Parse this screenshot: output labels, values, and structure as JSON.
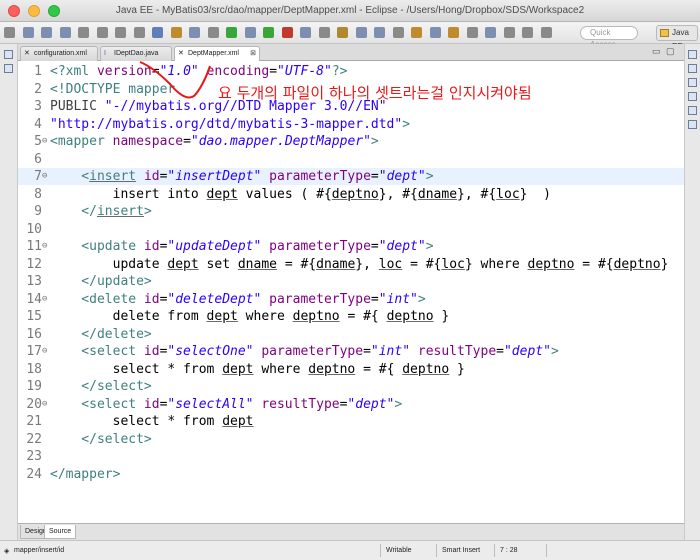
{
  "window": {
    "title": "Java EE - MyBatis03/src/dao/mapper/DeptMapper.xml - Eclipse - /Users/Hong/Dropbox/SDS/Workspace2"
  },
  "toolbar": {
    "quick_access_placeholder": "Quick Access",
    "perspective": "Java EE"
  },
  "tabs": [
    {
      "label": "configuration.xml",
      "icon": "xml-file-icon"
    },
    {
      "label": "IDeptDao.java",
      "icon": "java-interface-icon"
    },
    {
      "label": "DeptMapper.xml",
      "icon": "xml-file-icon",
      "active": true
    }
  ],
  "annotation": "요 두개의 파일이 하나의 셋트라는걸 인지시켜야됨",
  "code_lines": [
    {
      "num": "1",
      "fold": "",
      "current": false,
      "tokens": [
        {
          "t": "<?xml ",
          "c": "tag"
        },
        {
          "t": "version",
          "c": "attr"
        },
        {
          "t": "=",
          "c": ""
        },
        {
          "t": "\"1.0\"",
          "c": "val"
        },
        {
          "t": " encoding",
          "c": "attr"
        },
        {
          "t": "=",
          "c": ""
        },
        {
          "t": "\"UTF-8\"",
          "c": "val"
        },
        {
          "t": "?>",
          "c": "tag"
        }
      ]
    },
    {
      "num": "2",
      "fold": "",
      "current": false,
      "tokens": [
        {
          "t": "<!DOCTYPE mapper",
          "c": "tag"
        }
      ]
    },
    {
      "num": "3",
      "fold": "",
      "current": false,
      "tokens": [
        {
          "t": "PUBLIC ",
          "c": "dt"
        },
        {
          "t": "\"-//mybatis.org//DTD Mapper 3.0//EN\"",
          "c": "str"
        }
      ]
    },
    {
      "num": "4",
      "fold": "",
      "current": false,
      "tokens": [
        {
          "t": "\"http://mybatis.org/dtd/mybatis-3-mapper.dtd\"",
          "c": "str"
        },
        {
          "t": ">",
          "c": "tag"
        }
      ]
    },
    {
      "num": "5",
      "fold": "⊖",
      "current": false,
      "tokens": [
        {
          "t": "<mapper ",
          "c": "tag"
        },
        {
          "t": "namespace",
          "c": "attr"
        },
        {
          "t": "=",
          "c": ""
        },
        {
          "t": "\"dao.mapper.DeptMapper\"",
          "c": "val"
        },
        {
          "t": ">",
          "c": "tag"
        }
      ]
    },
    {
      "num": "6",
      "fold": "",
      "current": false,
      "tokens": []
    },
    {
      "num": "7",
      "fold": "⊖",
      "current": true,
      "tokens": [
        {
          "t": "    <",
          "c": "tag"
        },
        {
          "t": "insert",
          "c": "tag ul"
        },
        {
          "t": " ",
          "c": ""
        },
        {
          "t": "id",
          "c": "attr"
        },
        {
          "t": "=",
          "c": ""
        },
        {
          "t": "\"insertDept\"",
          "c": "val"
        },
        {
          "t": " parameterType",
          "c": "attr"
        },
        {
          "t": "=",
          "c": ""
        },
        {
          "t": "\"dept\"",
          "c": "val"
        },
        {
          "t": ">",
          "c": "tag"
        }
      ]
    },
    {
      "num": "8",
      "fold": "",
      "current": false,
      "tokens": [
        {
          "t": "        insert into ",
          "c": ""
        },
        {
          "t": "dept",
          "c": "ul"
        },
        {
          "t": " values ( #{",
          "c": ""
        },
        {
          "t": "deptno",
          "c": "ul"
        },
        {
          "t": "}, #{",
          "c": ""
        },
        {
          "t": "dname",
          "c": "ul"
        },
        {
          "t": "}, #{",
          "c": ""
        },
        {
          "t": "loc",
          "c": "ul"
        },
        {
          "t": "}  )",
          "c": ""
        }
      ]
    },
    {
      "num": "9",
      "fold": "",
      "current": false,
      "tokens": [
        {
          "t": "    </",
          "c": "tag"
        },
        {
          "t": "insert",
          "c": "tag ul"
        },
        {
          "t": ">",
          "c": "tag"
        }
      ]
    },
    {
      "num": "10",
      "fold": "",
      "current": false,
      "tokens": []
    },
    {
      "num": "11",
      "fold": "⊖",
      "current": false,
      "tokens": [
        {
          "t": "    <update ",
          "c": "tag"
        },
        {
          "t": "id",
          "c": "attr"
        },
        {
          "t": "=",
          "c": ""
        },
        {
          "t": "\"updateDept\"",
          "c": "val"
        },
        {
          "t": " parameterType",
          "c": "attr"
        },
        {
          "t": "=",
          "c": ""
        },
        {
          "t": "\"dept\"",
          "c": "val"
        },
        {
          "t": ">",
          "c": "tag"
        }
      ]
    },
    {
      "num": "12",
      "fold": "",
      "current": false,
      "tokens": [
        {
          "t": "        update ",
          "c": ""
        },
        {
          "t": "dept",
          "c": "ul"
        },
        {
          "t": " set ",
          "c": ""
        },
        {
          "t": "dname",
          "c": "ul"
        },
        {
          "t": " = #{",
          "c": ""
        },
        {
          "t": "dname",
          "c": "ul"
        },
        {
          "t": "}, ",
          "c": ""
        },
        {
          "t": "loc",
          "c": "ul"
        },
        {
          "t": " = #{",
          "c": ""
        },
        {
          "t": "loc",
          "c": "ul"
        },
        {
          "t": "} where ",
          "c": ""
        },
        {
          "t": "deptno",
          "c": "ul"
        },
        {
          "t": " = #{",
          "c": ""
        },
        {
          "t": "deptno",
          "c": "ul"
        },
        {
          "t": "}",
          "c": ""
        }
      ]
    },
    {
      "num": "13",
      "fold": "",
      "current": false,
      "tokens": [
        {
          "t": "    </update>",
          "c": "tag"
        }
      ]
    },
    {
      "num": "14",
      "fold": "⊖",
      "current": false,
      "tokens": [
        {
          "t": "    <delete ",
          "c": "tag"
        },
        {
          "t": "id",
          "c": "attr"
        },
        {
          "t": "=",
          "c": ""
        },
        {
          "t": "\"deleteDept\"",
          "c": "val"
        },
        {
          "t": " parameterType",
          "c": "attr"
        },
        {
          "t": "=",
          "c": ""
        },
        {
          "t": "\"int\"",
          "c": "val"
        },
        {
          "t": ">",
          "c": "tag"
        }
      ]
    },
    {
      "num": "15",
      "fold": "",
      "current": false,
      "tokens": [
        {
          "t": "        delete from ",
          "c": ""
        },
        {
          "t": "dept",
          "c": "ul"
        },
        {
          "t": " where ",
          "c": ""
        },
        {
          "t": "deptno",
          "c": "ul"
        },
        {
          "t": " = #{ ",
          "c": ""
        },
        {
          "t": "deptno",
          "c": "ul"
        },
        {
          "t": " }",
          "c": ""
        }
      ]
    },
    {
      "num": "16",
      "fold": "",
      "current": false,
      "tokens": [
        {
          "t": "    </delete>",
          "c": "tag"
        }
      ]
    },
    {
      "num": "17",
      "fold": "⊖",
      "current": false,
      "tokens": [
        {
          "t": "    <select ",
          "c": "tag"
        },
        {
          "t": "id",
          "c": "attr"
        },
        {
          "t": "=",
          "c": ""
        },
        {
          "t": "\"selectOne\"",
          "c": "val"
        },
        {
          "t": " parameterType",
          "c": "attr"
        },
        {
          "t": "=",
          "c": ""
        },
        {
          "t": "\"int\"",
          "c": "val"
        },
        {
          "t": " resultType",
          "c": "attr"
        },
        {
          "t": "=",
          "c": ""
        },
        {
          "t": "\"dept\"",
          "c": "val"
        },
        {
          "t": ">",
          "c": "tag"
        }
      ]
    },
    {
      "num": "18",
      "fold": "",
      "current": false,
      "tokens": [
        {
          "t": "        select * from ",
          "c": ""
        },
        {
          "t": "dept",
          "c": "ul"
        },
        {
          "t": " where ",
          "c": ""
        },
        {
          "t": "deptno",
          "c": "ul"
        },
        {
          "t": " = #{ ",
          "c": ""
        },
        {
          "t": "deptno",
          "c": "ul"
        },
        {
          "t": " }",
          "c": ""
        }
      ]
    },
    {
      "num": "19",
      "fold": "",
      "current": false,
      "tokens": [
        {
          "t": "    </select>",
          "c": "tag"
        }
      ]
    },
    {
      "num": "20",
      "fold": "⊖",
      "current": false,
      "tokens": [
        {
          "t": "    <select ",
          "c": "tag"
        },
        {
          "t": "id",
          "c": "attr"
        },
        {
          "t": "=",
          "c": ""
        },
        {
          "t": "\"selectAll\"",
          "c": "val"
        },
        {
          "t": " resultType",
          "c": "attr"
        },
        {
          "t": "=",
          "c": ""
        },
        {
          "t": "\"dept\"",
          "c": "val"
        },
        {
          "t": ">",
          "c": "tag"
        }
      ]
    },
    {
      "num": "21",
      "fold": "",
      "current": false,
      "tokens": [
        {
          "t": "        select * from ",
          "c": ""
        },
        {
          "t": "dept",
          "c": "ul"
        }
      ]
    },
    {
      "num": "22",
      "fold": "",
      "current": false,
      "tokens": [
        {
          "t": "    </select>",
          "c": "tag"
        }
      ]
    },
    {
      "num": "23",
      "fold": "",
      "current": false,
      "tokens": []
    },
    {
      "num": "24",
      "fold": "",
      "current": false,
      "tokens": [
        {
          "t": "</mapper>",
          "c": "tag"
        }
      ]
    }
  ],
  "bottom_tabs": [
    {
      "label": "Design"
    },
    {
      "label": "Source",
      "active": true
    }
  ],
  "status": {
    "path": "mapper/insert/id",
    "mode": "Writable",
    "insert": "Smart Insert",
    "position": "7 : 28"
  },
  "colors": {
    "tag": "#3f7f7f",
    "attr": "#7f007f",
    "value": "#2a00ff",
    "annotation": "#e81818",
    "current_line": "#e8f2fe"
  }
}
